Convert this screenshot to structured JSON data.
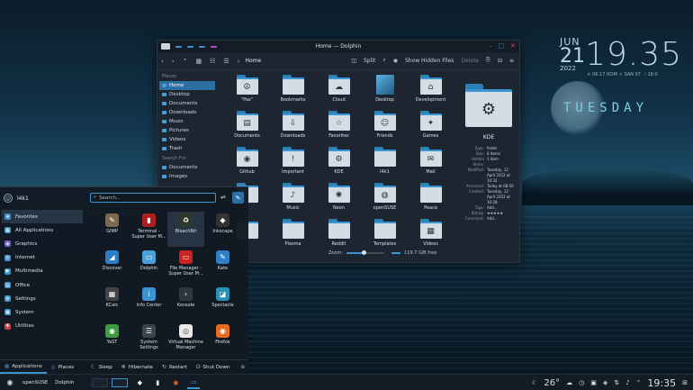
{
  "clock": {
    "month": "JUN",
    "day": "21",
    "year": "2022",
    "time": "19.35",
    "sun": "☀ 06:17 ROM ☼ SAN 07 ☽ 18:0",
    "weekday": "TUESDAY"
  },
  "dolphin": {
    "title": "Home — Dolphin",
    "dots": [
      "#3b94cf",
      "#3b94cf",
      "#3b94cf",
      "#b04fcf"
    ],
    "breadcrumb": "Home",
    "split_label": "Split",
    "hidden_label": "Show Hidden Files",
    "delete_label": "Delete",
    "places_header": "Places",
    "search_header": "Search For",
    "places": [
      "Home",
      "Desktop",
      "Documents",
      "Downloads",
      "Music",
      "Pictures",
      "Videos",
      "Trash"
    ],
    "search": [
      "Documents",
      "Images"
    ],
    "files": [
      {
        "name": "\"Pax\"",
        "glyph": "☮",
        "kind": "folder"
      },
      {
        "name": "Bookmarks",
        "glyph": "",
        "kind": "folder"
      },
      {
        "name": "Cloud",
        "glyph": "☁",
        "kind": "folder"
      },
      {
        "name": "Desktop",
        "glyph": "",
        "kind": "desktop"
      },
      {
        "name": "Development",
        "glyph": "⌂",
        "kind": "folder"
      },
      {
        "name": "Documents",
        "glyph": "▤",
        "kind": "folder"
      },
      {
        "name": "Downloads",
        "glyph": "⇩",
        "kind": "folder"
      },
      {
        "name": "Favorites",
        "glyph": "☆",
        "kind": "folder"
      },
      {
        "name": "Friends",
        "glyph": "☺",
        "kind": "folder"
      },
      {
        "name": "Games",
        "glyph": "✦",
        "kind": "folder"
      },
      {
        "name": "Github",
        "glyph": "◉",
        "kind": "folder"
      },
      {
        "name": "Important",
        "glyph": "!",
        "kind": "folder"
      },
      {
        "name": "KDE",
        "glyph": "⚙",
        "kind": "folder"
      },
      {
        "name": "l4k1",
        "glyph": "",
        "kind": "folder"
      },
      {
        "name": "Mail",
        "glyph": "✉",
        "kind": "folder"
      },
      {
        "name": "",
        "glyph": "",
        "kind": "folder"
      },
      {
        "name": "Music",
        "glyph": "♪",
        "kind": "folder"
      },
      {
        "name": "Neon",
        "glyph": "✺",
        "kind": "folder"
      },
      {
        "name": "openSUSE",
        "glyph": "◍",
        "kind": "folder"
      },
      {
        "name": "Peace",
        "glyph": "",
        "kind": "folder"
      },
      {
        "name": "",
        "glyph": "",
        "kind": "folder"
      },
      {
        "name": "Plasma",
        "glyph": "",
        "kind": "folder"
      },
      {
        "name": "Reddit",
        "glyph": "",
        "kind": "folder"
      },
      {
        "name": "Templates",
        "glyph": "",
        "kind": "folder"
      },
      {
        "name": "Videos",
        "glyph": "▦",
        "kind": "folder"
      }
    ],
    "info": {
      "name": "KDE",
      "rows": [
        {
          "k": "Type:",
          "v": "folder"
        },
        {
          "k": "Size:",
          "v": "8 items"
        },
        {
          "k": "Hidden Items:",
          "v": "1 item"
        },
        {
          "k": "Modified:",
          "v": "Tuesday, 12 April 2022 at 10:32"
        },
        {
          "k": "Accessed:",
          "v": "Today at 08:50"
        },
        {
          "k": "Created:",
          "v": "Tuesday, 12 April 2022 at 10:28"
        },
        {
          "k": "Tags:",
          "v": "Add..."
        },
        {
          "k": "Rating:",
          "v": "★★★★★"
        },
        {
          "k": "Comment:",
          "v": "Add..."
        }
      ]
    },
    "zoom_label": "Zoom:",
    "zoom_level": 0.45,
    "free_space": "119.7 GiB free"
  },
  "launcher": {
    "user": "l4k1",
    "search_placeholder": "Search...",
    "categories": [
      {
        "label": "Favorites",
        "icon": "★",
        "color": "#3b94cf"
      },
      {
        "label": "All Applications",
        "icon": "▦",
        "color": "#3b94cf"
      },
      {
        "label": "Graphics",
        "icon": "◈",
        "color": "#7a5fd1"
      },
      {
        "label": "Internet",
        "icon": "◎",
        "color": "#3b94cf"
      },
      {
        "label": "Multimedia",
        "icon": "▶",
        "color": "#3b94cf"
      },
      {
        "label": "Office",
        "icon": "▤",
        "color": "#3b94cf"
      },
      {
        "label": "Settings",
        "icon": "⚙",
        "color": "#3b94cf"
      },
      {
        "label": "System",
        "icon": "▣",
        "color": "#3b94cf"
      },
      {
        "label": "Utilities",
        "icon": "✚",
        "color": "#d04040"
      }
    ],
    "apps": [
      {
        "label": "GIMP",
        "icon": "✎",
        "color": "#7b6a4a"
      },
      {
        "label": "Terminal - Super User M...",
        "icon": "▮",
        "color": "#b01e1e"
      },
      {
        "label": "BleachBit",
        "icon": "♻",
        "color": "#2f3b2a"
      },
      {
        "label": "Inkscape",
        "icon": "◆",
        "color": "#333"
      },
      {
        "label": "Discover",
        "icon": "◢",
        "color": "#2b7ec6"
      },
      {
        "label": "Dolphin",
        "icon": "▭",
        "color": "#4aa0d8"
      },
      {
        "label": "File Manager - Super User M...",
        "icon": "▭",
        "color": "#c22"
      },
      {
        "label": "Kate",
        "icon": "✎",
        "color": "#2f7fc7"
      },
      {
        "label": "KCalc",
        "icon": "▦",
        "color": "#444"
      },
      {
        "label": "Info Center",
        "icon": "i",
        "color": "#3b94cf"
      },
      {
        "label": "Konsole",
        "icon": "›",
        "color": "#2f3640"
      },
      {
        "label": "Spectacle",
        "icon": "◪",
        "color": "#2c8fb8"
      },
      {
        "label": "YaST",
        "icon": "◉",
        "color": "#3e9b3e"
      },
      {
        "label": "System Settings",
        "icon": "☰",
        "color": "#3a444f"
      },
      {
        "label": "Virtual Machine Manager",
        "icon": "◎",
        "color": "#e8e8e8"
      },
      {
        "label": "Firefox",
        "icon": "◉",
        "color": "#e66a1f"
      }
    ],
    "tab_apps": "Applications",
    "tab_places": "Places",
    "sleep": "Sleep",
    "hibernate": "Hibernate",
    "restart": "Restart",
    "shutdown": "Shut Down"
  },
  "taskbar": {
    "distro": "openSUSE",
    "app": "Dolphin",
    "temperature": "26°",
    "time": "19:35"
  }
}
